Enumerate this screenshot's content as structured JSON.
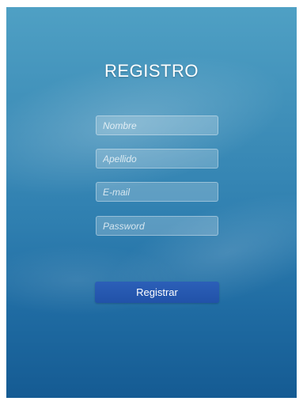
{
  "form": {
    "title": "REGISTRO",
    "fields": [
      {
        "name": "nombre",
        "placeholder": "Nombre",
        "value": ""
      },
      {
        "name": "apellido",
        "placeholder": "Apellido",
        "value": ""
      },
      {
        "name": "email",
        "placeholder": "E-mail",
        "value": ""
      },
      {
        "name": "password",
        "placeholder": "Password",
        "value": ""
      }
    ],
    "submit_label": "Registrar"
  },
  "colors": {
    "background_top": "#4fa0c4",
    "background_bottom": "#155b93",
    "button": "#2558ae",
    "text": "#ffffff"
  }
}
